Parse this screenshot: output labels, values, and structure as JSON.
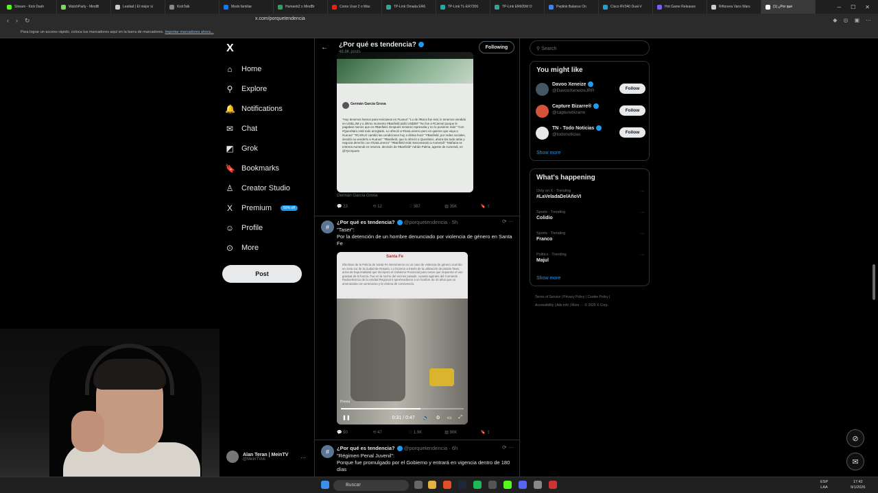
{
  "browser": {
    "tabs": [
      {
        "label": "Stream - Kick Dash",
        "color": "#53fc18"
      },
      {
        "label": "WatchParty - MindB",
        "color": "#7ed957"
      },
      {
        "label": "Lealtad | El mejor si",
        "color": "#cccccc"
      },
      {
        "label": "KickTalk",
        "color": "#888888"
      },
      {
        "label": "Modo familiar",
        "color": "#1877f2"
      },
      {
        "label": "HumanitZ x MindBr",
        "color": "#26a65b"
      },
      {
        "label": "Como Usar 2 o Más",
        "color": "#e62117"
      },
      {
        "label": "TP-Link Omada ER6",
        "color": "#2aa7a1"
      },
      {
        "label": "TP-Link TL-ER7206",
        "color": "#2aa7a1"
      },
      {
        "label": "TP-Link ER605W D",
        "color": "#2aa7a1"
      },
      {
        "label": "Peplink Balance On",
        "color": "#3b82f6"
      },
      {
        "label": "Cisco RV340 Dual-V",
        "color": "#1ba0d7"
      },
      {
        "label": "Hot Game Releases",
        "color": "#7b5cff"
      },
      {
        "label": "Riñonera Vans Wars",
        "color": "#cccccc"
      },
      {
        "label": "(1) ¿Por qué",
        "color": "#ffffff"
      }
    ],
    "url": "x.com/porquetendencia",
    "bookmarks_text": "Para lograr un acceso rápido, coloca tus marcadores aquí en la barra de marcadores.",
    "bookmarks_link": "Importar marcadores ahora..."
  },
  "nav": {
    "logo": "X",
    "items": [
      {
        "label": "Home",
        "icon": "⌂"
      },
      {
        "label": "Explore",
        "icon": "⚲"
      },
      {
        "label": "Notifications",
        "icon": "🔔"
      },
      {
        "label": "Chat",
        "icon": "✉"
      },
      {
        "label": "Grok",
        "icon": "◩"
      },
      {
        "label": "Bookmarks",
        "icon": "🔖"
      },
      {
        "label": "Creator Studio",
        "icon": "♙"
      },
      {
        "label": "Premium",
        "icon": "X"
      },
      {
        "label": "Profile",
        "icon": "☺"
      },
      {
        "label": "More",
        "icon": "⊙"
      }
    ],
    "premium_badge": "50% off",
    "post_button": "Post",
    "account_name": "Alan Teran | MeinTV",
    "account_handle": "@MeInTVok",
    "account_more": "···"
  },
  "header": {
    "title": "¿Por qué es tendencia?",
    "posts_count": "48.8K posts",
    "following_button": "Following",
    "back_icon": "←"
  },
  "tweet1": {
    "quoted_author": "Germán García Grova",
    "quoted_text": "\"Hoy tenemos harsos para revicamos en #Lanus\" \"Lo de #Boca fue real, lo tenemos vendido en US$1,3M y a último momento #Banfield pidió US$2M\" \"No fue a #Cannel porque le pagaban menos que en #Banfield. Después tomaron represalia y no lo pusieron más\" \"Con #Querétaro está todo arreglado. Lo ofreció a #SanLorenzo pero en quieren que vaya a #Lanus\" \"#CARLO cambió las condiciones hoy a última hora\" \"#Banfield, por redes sociales, decidió no venderlo a #Lanus\" \"#Banfield, que lo ofreció a Querétaro, ahora tira todo atrás y negocia derecho con #SanLorenzo\" \"#Banfield está manoseando a Aumendi\" \"Mañana se entrena Aumendi en reserva, decisión de #Banfield\" Adrián Palma, agente de Aumendi, en @TyCSports",
    "image_caption": "Germán García Grova",
    "replies": "23",
    "reposts": "12",
    "likes": "387",
    "views": "35K"
  },
  "tweet2": {
    "author": "¿Por qué es tendencia?",
    "handle": "@porquetendencia · 5h",
    "text_line1": "\"Taser\":",
    "text_line2": "Por la detención de un hombre denunciado por violencia de género en Santa Fe",
    "video_logo": "Santa Fe",
    "video_doc_text": "Efectivos de la Policía de Santa Fe intervinieron en un caso de violencia de género ocurrido en zona sur de la ciudad de Rosario. Lo hicieron a través de la utilización de pistola Taser, arma de baja letalidad que incorporó el Gobierno Provincial para casos que requieran el uso gradual de la fuerza. Fue en la noche del viernes pasado, cuando agentes del Comando Radioeléctrico de la Unidad Regional II aprehendieron a un hombre de 32 años que no amenazaba con amenazas y la víctima de convivencia.",
    "video_label": "Previa",
    "video_time": "0:31 / 0:47",
    "video_progress": 0.65,
    "replies": "50",
    "reposts": "47",
    "likes": "1.9K",
    "views": "90K"
  },
  "tweet3": {
    "author": "¿Por qué es tendencia?",
    "handle": "@porquetendencia · 6h",
    "text_line1": "\"Régimen Penal Juvenil\":",
    "text_line2": "Porque fue promulgado por el Gobierno y entrará en vigencia dentro de 180 días"
  },
  "right": {
    "search_placeholder": "Search",
    "you_might_like": "You might like",
    "suggestions": [
      {
        "name": "Davoo Xeneize",
        "handle": "@DavooXeneizeJRR",
        "follow": "Follow",
        "color": "#445566"
      },
      {
        "name": "Capture Bizarre®",
        "handle": "@capturebizarre",
        "follow": "Follow",
        "color": "#d6533b"
      },
      {
        "name": "TN - Todo Noticias",
        "handle": "@todonoticias",
        "follow": "Follow",
        "color": "#e8e8e8"
      }
    ],
    "show_more": "Show more",
    "whats_happening": "What's happening",
    "trends": [
      {
        "category": "Only on X · Trending",
        "topic": "#LaVeladaDelAñoVI"
      },
      {
        "category": "Sports · Trending",
        "topic": "Colidio"
      },
      {
        "category": "Sports · Trending",
        "topic": "Franco"
      },
      {
        "category": "Politics · Trending",
        "topic": "Majul"
      }
    ],
    "show_more_2": "Show more",
    "footer_line1": "Terms of Service  |  Privacy Policy  |  Cookie Policy  |",
    "footer_line2": "Accessibility  |  Ads info  |  More ···  © 2025 X Corp."
  },
  "taskbar": {
    "search": "Buscar",
    "lang": "ESP",
    "lang2": "LAA",
    "time": "17:42",
    "date": "9/1/2026"
  }
}
